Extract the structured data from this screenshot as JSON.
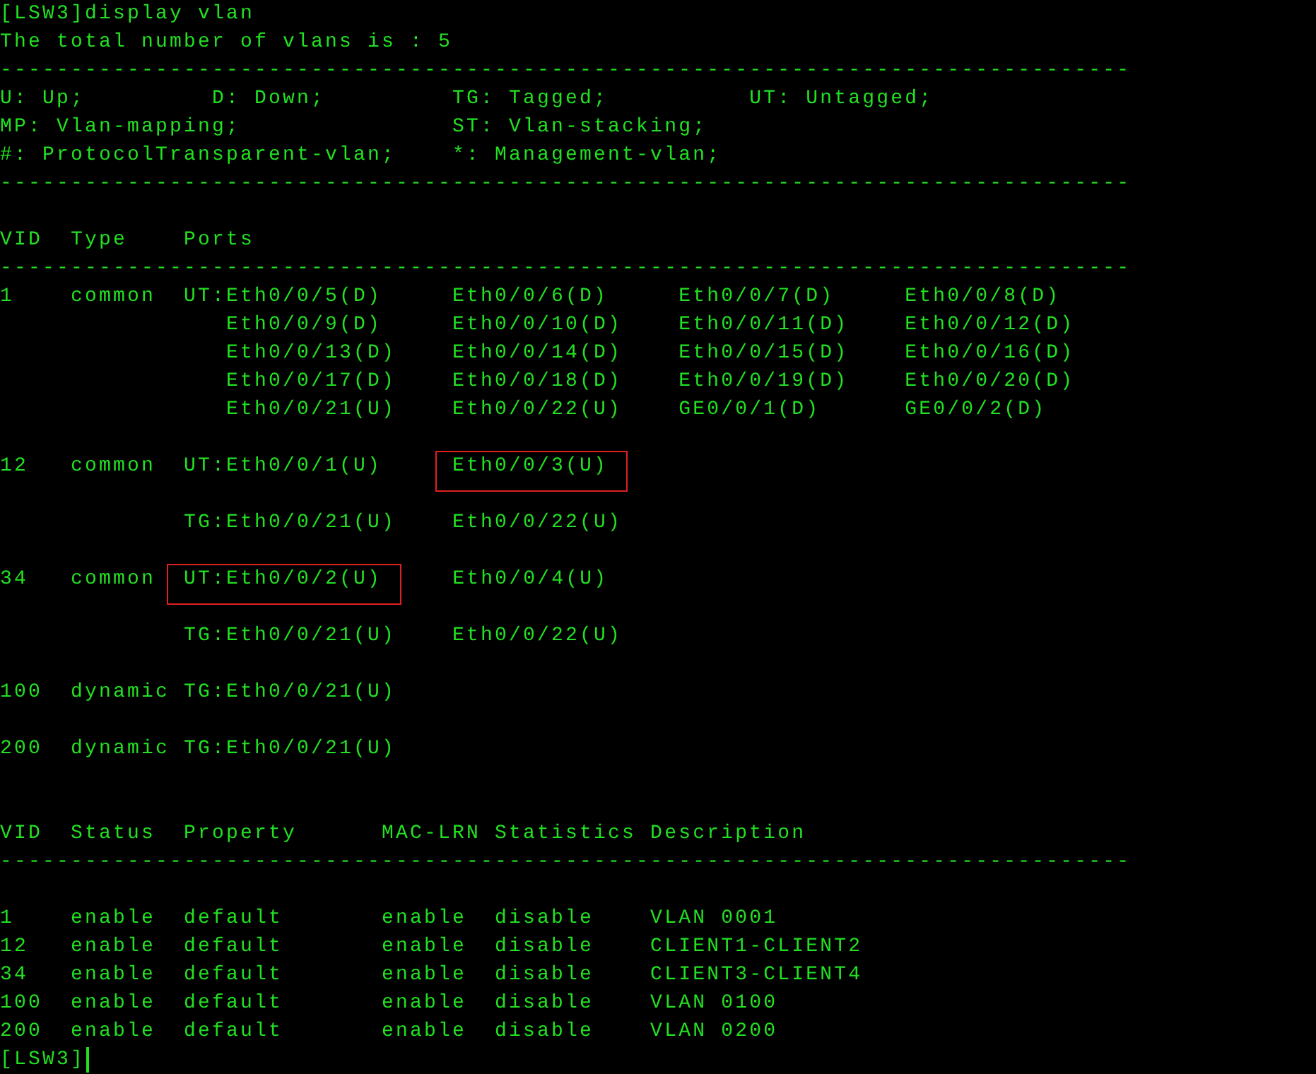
{
  "terminal": {
    "lines": [
      {
        "kind": "text",
        "parts": [
          {
            "text": "[LSW3]display vlan",
            "boxed": false
          }
        ]
      },
      {
        "kind": "text",
        "parts": [
          {
            "text": "The total number of vlans is : 5",
            "boxed": false
          }
        ]
      },
      {
        "kind": "text",
        "parts": [
          {
            "text": "--------------------------------------------------------------------------------",
            "boxed": false
          }
        ]
      },
      {
        "kind": "text",
        "parts": [
          {
            "text": "U: Up;         D: Down;         TG: Tagged;          UT: Untagged;",
            "boxed": false
          }
        ]
      },
      {
        "kind": "text",
        "parts": [
          {
            "text": "MP: Vlan-mapping;               ST: Vlan-stacking;",
            "boxed": false
          }
        ]
      },
      {
        "kind": "text",
        "parts": [
          {
            "text": "#: ProtocolTransparent-vlan;    *: Management-vlan;",
            "boxed": false
          }
        ]
      },
      {
        "kind": "text",
        "parts": [
          {
            "text": "--------------------------------------------------------------------------------",
            "boxed": false
          }
        ]
      },
      {
        "kind": "blank"
      },
      {
        "kind": "text",
        "parts": [
          {
            "text": "VID  Type    Ports",
            "boxed": false
          }
        ]
      },
      {
        "kind": "text",
        "parts": [
          {
            "text": "--------------------------------------------------------------------------------",
            "boxed": false
          }
        ]
      },
      {
        "kind": "text",
        "parts": [
          {
            "text": "1    common  UT:Eth0/0/5(D)     Eth0/0/6(D)     Eth0/0/7(D)     Eth0/0/8(D)",
            "boxed": false
          }
        ]
      },
      {
        "kind": "text",
        "parts": [
          {
            "text": "                Eth0/0/9(D)     Eth0/0/10(D)    Eth0/0/11(D)    Eth0/0/12(D)",
            "boxed": false
          }
        ]
      },
      {
        "kind": "text",
        "parts": [
          {
            "text": "                Eth0/0/13(D)    Eth0/0/14(D)    Eth0/0/15(D)    Eth0/0/16(D)",
            "boxed": false
          }
        ]
      },
      {
        "kind": "text",
        "parts": [
          {
            "text": "                Eth0/0/17(D)    Eth0/0/18(D)    Eth0/0/19(D)    Eth0/0/20(D)",
            "boxed": false
          }
        ]
      },
      {
        "kind": "text",
        "parts": [
          {
            "text": "                Eth0/0/21(U)    Eth0/0/22(U)    GE0/0/1(D)      GE0/0/2(D)",
            "boxed": false
          }
        ]
      },
      {
        "kind": "blank"
      },
      {
        "kind": "text",
        "parts": [
          {
            "text": "12   common  UT:Eth0/0/1(U)     ",
            "boxed": false
          },
          {
            "text": "Eth0/0/3(U)",
            "boxed": true
          }
        ]
      },
      {
        "kind": "blank"
      },
      {
        "kind": "text",
        "parts": [
          {
            "text": "             TG:Eth0/0/21(U)    Eth0/0/22(U)",
            "boxed": false
          }
        ]
      },
      {
        "kind": "blank"
      },
      {
        "kind": "text",
        "parts": [
          {
            "text": "34   common  ",
            "boxed": false
          },
          {
            "text": "UT:Eth0/0/2(U)",
            "boxed": true
          },
          {
            "text": "     Eth0/0/4(U)",
            "boxed": false
          }
        ]
      },
      {
        "kind": "blank"
      },
      {
        "kind": "text",
        "parts": [
          {
            "text": "             TG:Eth0/0/21(U)    Eth0/0/22(U)",
            "boxed": false
          }
        ]
      },
      {
        "kind": "blank"
      },
      {
        "kind": "text",
        "parts": [
          {
            "text": "100  dynamic TG:Eth0/0/21(U)",
            "boxed": false
          }
        ]
      },
      {
        "kind": "blank"
      },
      {
        "kind": "text",
        "parts": [
          {
            "text": "200  dynamic TG:Eth0/0/21(U)",
            "boxed": false
          }
        ]
      },
      {
        "kind": "blank"
      },
      {
        "kind": "blank"
      },
      {
        "kind": "text",
        "parts": [
          {
            "text": "VID  Status  Property      MAC-LRN Statistics Description",
            "boxed": false
          }
        ]
      },
      {
        "kind": "text",
        "parts": [
          {
            "text": "--------------------------------------------------------------------------------",
            "boxed": false
          }
        ]
      },
      {
        "kind": "blank"
      },
      {
        "kind": "text",
        "parts": [
          {
            "text": "1    enable  default       enable  disable    VLAN 0001",
            "boxed": false
          }
        ]
      },
      {
        "kind": "text",
        "parts": [
          {
            "text": "12   enable  default       enable  disable    CLIENT1-CLIENT2",
            "boxed": false
          }
        ]
      },
      {
        "kind": "text",
        "parts": [
          {
            "text": "34   enable  default       enable  disable    CLIENT3-CLIENT4",
            "boxed": false
          }
        ]
      },
      {
        "kind": "text",
        "parts": [
          {
            "text": "100  enable  default       enable  disable    VLAN 0100",
            "boxed": false
          }
        ]
      },
      {
        "kind": "text",
        "parts": [
          {
            "text": "200  enable  default       enable  disable    VLAN 0200",
            "boxed": false
          }
        ]
      },
      {
        "kind": "text",
        "cursor": true,
        "parts": [
          {
            "text": "[LSW3]",
            "boxed": false
          }
        ]
      }
    ]
  }
}
